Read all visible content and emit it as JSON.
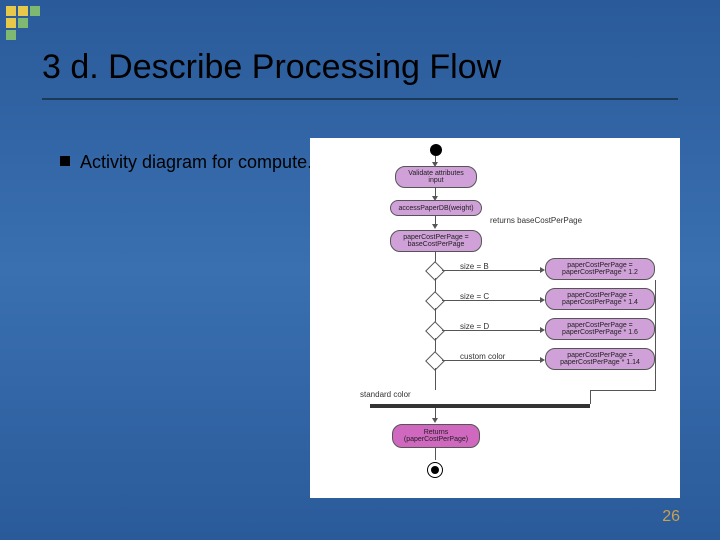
{
  "slide": {
    "title": "3 d. Describe Processing Flow",
    "bullet": "Activity diagram for compute. Paper. Cost( )",
    "page_number": "26"
  },
  "diagram": {
    "nodes": {
      "validate": "Validate attributes input",
      "access": "accessPaperDB(weight)",
      "assign_base": "paperCostPerPage = baseCostPerPage",
      "returns_label": "returns baseCostPerPage",
      "mult12": "paperCostPerPage = paperCostPerPage * 1.2",
      "mult14": "paperCostPerPage = paperCostPerPage * 1.4",
      "mult16": "paperCostPerPage = paperCostPerPage * 1.6",
      "mult114": "paperCostPerPage = paperCostPerPage * 1.14",
      "return": "Returns (paperCostPerPage)"
    },
    "labels": {
      "sizeB": "size = B",
      "sizeC": "size = C",
      "sizeD": "size = D",
      "custom": "custom color",
      "standard": "standard color"
    }
  }
}
